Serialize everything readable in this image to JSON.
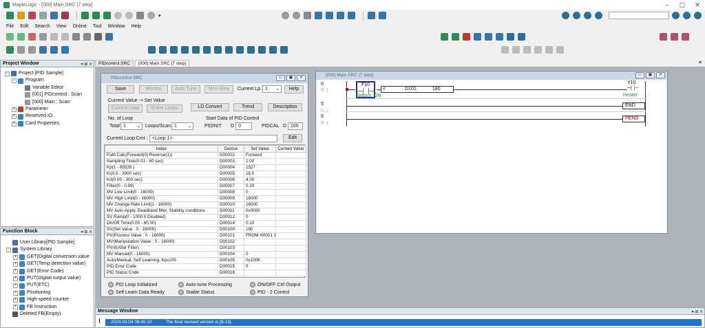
{
  "app": {
    "title": "MapleLogic - [000] Main.SRC [7 step]",
    "win_min": "–",
    "win_max": "▢",
    "win_close": "✕"
  },
  "menu": [
    "File",
    "Edit",
    "Search",
    "View",
    "Online",
    "Tool",
    "Window",
    "Help"
  ],
  "toolbar": {
    "dropdown_arrow": "▾"
  },
  "project_window": {
    "title": "Project Window",
    "ctl": "▾ ⊞ ✕",
    "items": [
      {
        "label": "Project [PID Sample]",
        "pm": "−",
        "indent": 0,
        "icon": "#4a6fa5"
      },
      {
        "label": "Program",
        "pm": "−",
        "indent": 1,
        "icon": "#3b82c4"
      },
      {
        "label": "Variable Editor",
        "pm": "",
        "indent": 2,
        "icon": "#777"
      },
      {
        "label": "[001] PIDcontrol : Scan",
        "pm": "",
        "indent": 2,
        "icon": "#999"
      },
      {
        "label": "[000] Main : Scan",
        "pm": "",
        "indent": 2,
        "icon": "#999"
      },
      {
        "label": "Parameter",
        "pm": "+",
        "indent": 1,
        "icon": "#c0392b"
      },
      {
        "label": "Reserved IO",
        "pm": "+",
        "indent": 1,
        "icon": "#2e86c1"
      },
      {
        "label": "Card Properties",
        "pm": "+",
        "indent": 1,
        "icon": "#2e86c1"
      }
    ]
  },
  "function_block": {
    "title": "Function Block",
    "ctl": "▾ ⊞ ✕",
    "items": [
      {
        "label": "User Library[PID Sample]",
        "pm": "",
        "indent": 0,
        "icon": "#4a6fa5"
      },
      {
        "label": "System Library",
        "pm": "−",
        "indent": 0,
        "icon": "#4a6fa5"
      },
      {
        "label": "GET(Digital conversion value",
        "pm": "+",
        "indent": 1,
        "icon": "#3b82c4"
      },
      {
        "label": "GET(Temp detection value)",
        "pm": "+",
        "indent": 1,
        "icon": "#3b82c4"
      },
      {
        "label": "GET(Error Code)",
        "pm": "+",
        "indent": 1,
        "icon": "#3b82c4"
      },
      {
        "label": "PUT(Digital output value)",
        "pm": "+",
        "indent": 1,
        "icon": "#3b82c4"
      },
      {
        "label": "PUT(ETC)",
        "pm": "+",
        "indent": 1,
        "icon": "#3b82c4"
      },
      {
        "label": "Positioning",
        "pm": "+",
        "indent": 1,
        "icon": "#3b82c4"
      },
      {
        "label": "High-speed counter",
        "pm": "+",
        "indent": 1,
        "icon": "#3b82c4"
      },
      {
        "label": "FB Instruction",
        "pm": "+",
        "indent": 1,
        "icon": "#3b82c4"
      },
      {
        "label": "Deleted FB(Empty)",
        "pm": "",
        "indent": 0,
        "icon": "#555"
      }
    ]
  },
  "tabs": [
    "PIDcontrol.SRC",
    "[000] Main.SRC [7 step]"
  ],
  "tab_close": "✕",
  "pid_window": {
    "title": "PIDcontrol.SRC",
    "buttons": {
      "save": "Save",
      "monitor": "Monitor",
      "auto_tune": "Auto Tune",
      "mon_view": "Mon-View",
      "help": "Help",
      "current_loop": "Current Loop",
      "entire_loops": "Entire Loops",
      "ld_convert": "LD Convert",
      "trend": "Trend",
      "description": "Description",
      "edit": "Edit"
    },
    "current_lp_label": "Current Lp.",
    "current_lp_value": "1",
    "current_value_label": "Current Value -> Set Value",
    "no_of_loop_label": "No. of Loop",
    "total_label": "Total",
    "total_value": "1",
    "loops_scan_label": "Loops/Scan",
    "loops_scan_value": "1",
    "start_data_label": "Start Data of PID Control",
    "pidinit_label": "PIDINIT",
    "pidinit_dev": "D",
    "pidinit_value": "0",
    "pidcal_label": "PIDCAL",
    "pidcal_dev": "D",
    "pidcal_value": "100",
    "loop_cmt_label": "Current Loop Cmt :",
    "loop_cmt_value": "<Loop 1>",
    "table_headers": [
      "Index",
      "Device",
      "Set Value",
      "Current Value"
    ],
    "rows": [
      [
        "Path Calc(Forward(0) Reverse(1))",
        "D00002",
        "Forward",
        ""
      ],
      [
        "Sampling Time(0.01 - 60 sec)",
        "D00003",
        "1.00",
        ""
      ],
      [
        "Kp(1 - 65535 )",
        "D00004",
        "1527",
        ""
      ],
      [
        "Ki(0.0 - 3000 sec)",
        "D00005",
        "16.0",
        ""
      ],
      [
        "Kd(0.00 - 300 sec)",
        "D00006",
        "4.00",
        ""
      ],
      [
        "Filter(0 - 0.99)",
        "D00007",
        "0.20",
        ""
      ],
      [
        "MV Low Limit(0 - 16000)",
        "D00008",
        "0",
        ""
      ],
      [
        "MV High Limit(0 - 16000)",
        "D00009",
        "16000",
        ""
      ],
      [
        "MV Change Rate Limit(1 - 16000)",
        "D00010",
        "16000",
        ""
      ],
      [
        "MV Auto-Apply, Deadband filter, Stability conditions",
        "D00011",
        "0x0000",
        ""
      ],
      [
        "SV Ramp(0 - 1000    0:Disabled)",
        "D00012",
        "0",
        ""
      ],
      [
        "On/Off Time(0.00 - 60.00)",
        "D00014",
        "0.10",
        ""
      ],
      [
        "SV(Set Value : 0 - 16000)",
        "D00100",
        "180",
        ""
      ],
      [
        "PV(Process Value : 0 - 16000)",
        "D00101",
        "FROM H0001 1",
        ""
      ],
      [
        "MV(Manipulation Value : 0 - 16000)",
        "D00102",
        "",
        ""
      ],
      [
        "PVnf(After Filter)",
        "D00103",
        "",
        ""
      ],
      [
        "MV Manual(0 - 16000)",
        "D00104",
        "0",
        ""
      ],
      [
        "Auto/Manual, Self Learning, Kpx100",
        "D00105",
        "0x1006",
        ""
      ],
      [
        "PID Error Code",
        "D00015",
        "0",
        ""
      ],
      [
        "PID Status Code",
        "D00016",
        "",
        ""
      ]
    ],
    "status": [
      "PID Loop Initialized",
      "Auto-tune Processing",
      "ON/OFF Ctrl Output",
      "Self Learn Data Ready",
      "Stable Status",
      "PID - 2 Control"
    ]
  },
  "main_window": {
    "title": "[000] Main.SRC [7 step]",
    "rungs": [
      {
        "step": "0",
        "r": "R 1",
        "contact": "F10",
        "contact_cmt": "Always_ON",
        "cmp": "<",
        "d1": "D101",
        "d2": "180",
        "coil": "Y10",
        "coil_cmt": "Heater"
      },
      {
        "step": "5",
        "r": "R 2",
        "end": "END"
      },
      {
        "step": "6",
        "r": "R 3",
        "pend": "PEND"
      }
    ]
  },
  "message_window": {
    "title": "Message Window",
    "ctl": "▾ ⊞ ✕",
    "bang": "!",
    "timestamp": "2024.03.04 08:45:10",
    "text": "The final revised version is [8.13]."
  }
}
